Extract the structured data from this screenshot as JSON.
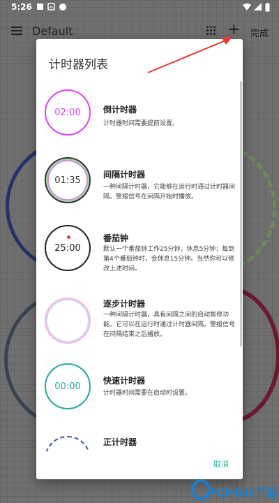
{
  "status_bar": {
    "time": "5:26"
  },
  "app_bar": {
    "title": "Default",
    "done_label": "完成"
  },
  "dialog": {
    "title": "计时器列表",
    "cancel_label": "取消",
    "items": [
      {
        "name": "倒计时器",
        "dial_text": "02:00",
        "dial_color": "#e040fb",
        "description": "计时器时间需要提前设置。"
      },
      {
        "name": "间隔计时器",
        "dial_text": "01:35",
        "dial_color": "#333333",
        "description": "一种间隔计时器，它能够在运行时通过计时器间隔。警报信号在间隔开始时播放。"
      },
      {
        "name": "番茄钟",
        "dial_text": "25:00",
        "dial_color": "#222222",
        "description": "默认一个番茄钟工作25分钟，休息5分钟；每到第4个番茄钟时，会休息15分钟。当然你可以修改上述时间。"
      },
      {
        "name": "逐步计时器",
        "dial_text": "",
        "dial_color": "#f0a8d8",
        "description": "一种间隔计时器，具有间隔之间的自动暂停功能。它可以在运行时通过计时器间隔。警报信号在间隔结束之后播放。"
      },
      {
        "name": "快速计时器",
        "dial_text": "00:00",
        "dial_color": "#26a69a",
        "description": "计时器时间需要在启动时设置。"
      },
      {
        "name": "正计时器",
        "dial_text": "",
        "dial_color": "#3f51b5",
        "description": ""
      }
    ]
  },
  "watermark": {
    "text": "PCPOO下载"
  }
}
